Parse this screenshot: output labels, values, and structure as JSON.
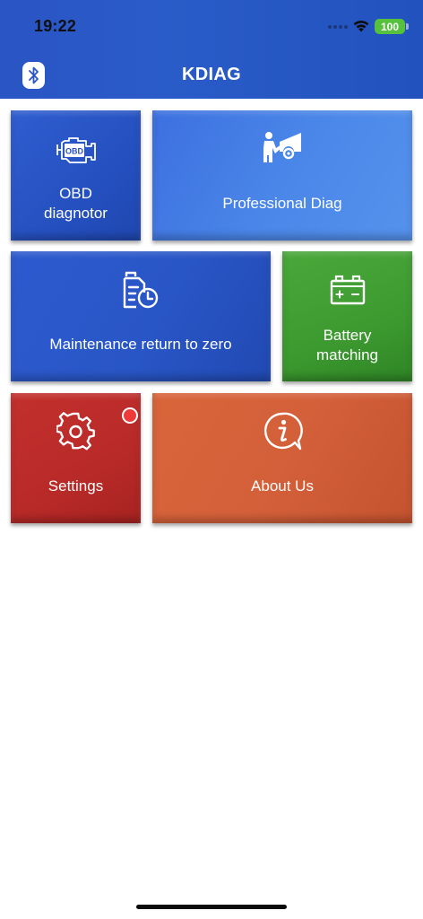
{
  "status_bar": {
    "time": "19:22",
    "battery_level": "100",
    "battery_color": "#55c13d"
  },
  "nav": {
    "title": "KDIAG",
    "bluetooth_icon": "bluetooth-icon"
  },
  "tiles": [
    {
      "id": "obd",
      "label": "OBD\ndiagnotor",
      "label_lines": [
        "OBD",
        "diagnotor"
      ],
      "icon": "engine-obd-icon",
      "color": "#2550c0"
    },
    {
      "id": "professional",
      "label": "Professional Diag",
      "icon": "mechanic-car-icon",
      "color": "#4a86e8"
    },
    {
      "id": "maintenance",
      "label": "Maintenance return to zero",
      "icon": "oil-clock-icon",
      "color": "#2956c6"
    },
    {
      "id": "battery",
      "label_lines": [
        "Battery",
        "matching"
      ],
      "icon": "car-battery-icon",
      "color": "#3d9a30"
    },
    {
      "id": "settings",
      "label": "Settings",
      "icon": "gear-icon",
      "color": "#b82a28",
      "has_notification": true
    },
    {
      "id": "about",
      "label": "About Us",
      "icon": "info-bubble-icon",
      "color": "#d4603a"
    }
  ],
  "obd_icon_text": "OBD"
}
